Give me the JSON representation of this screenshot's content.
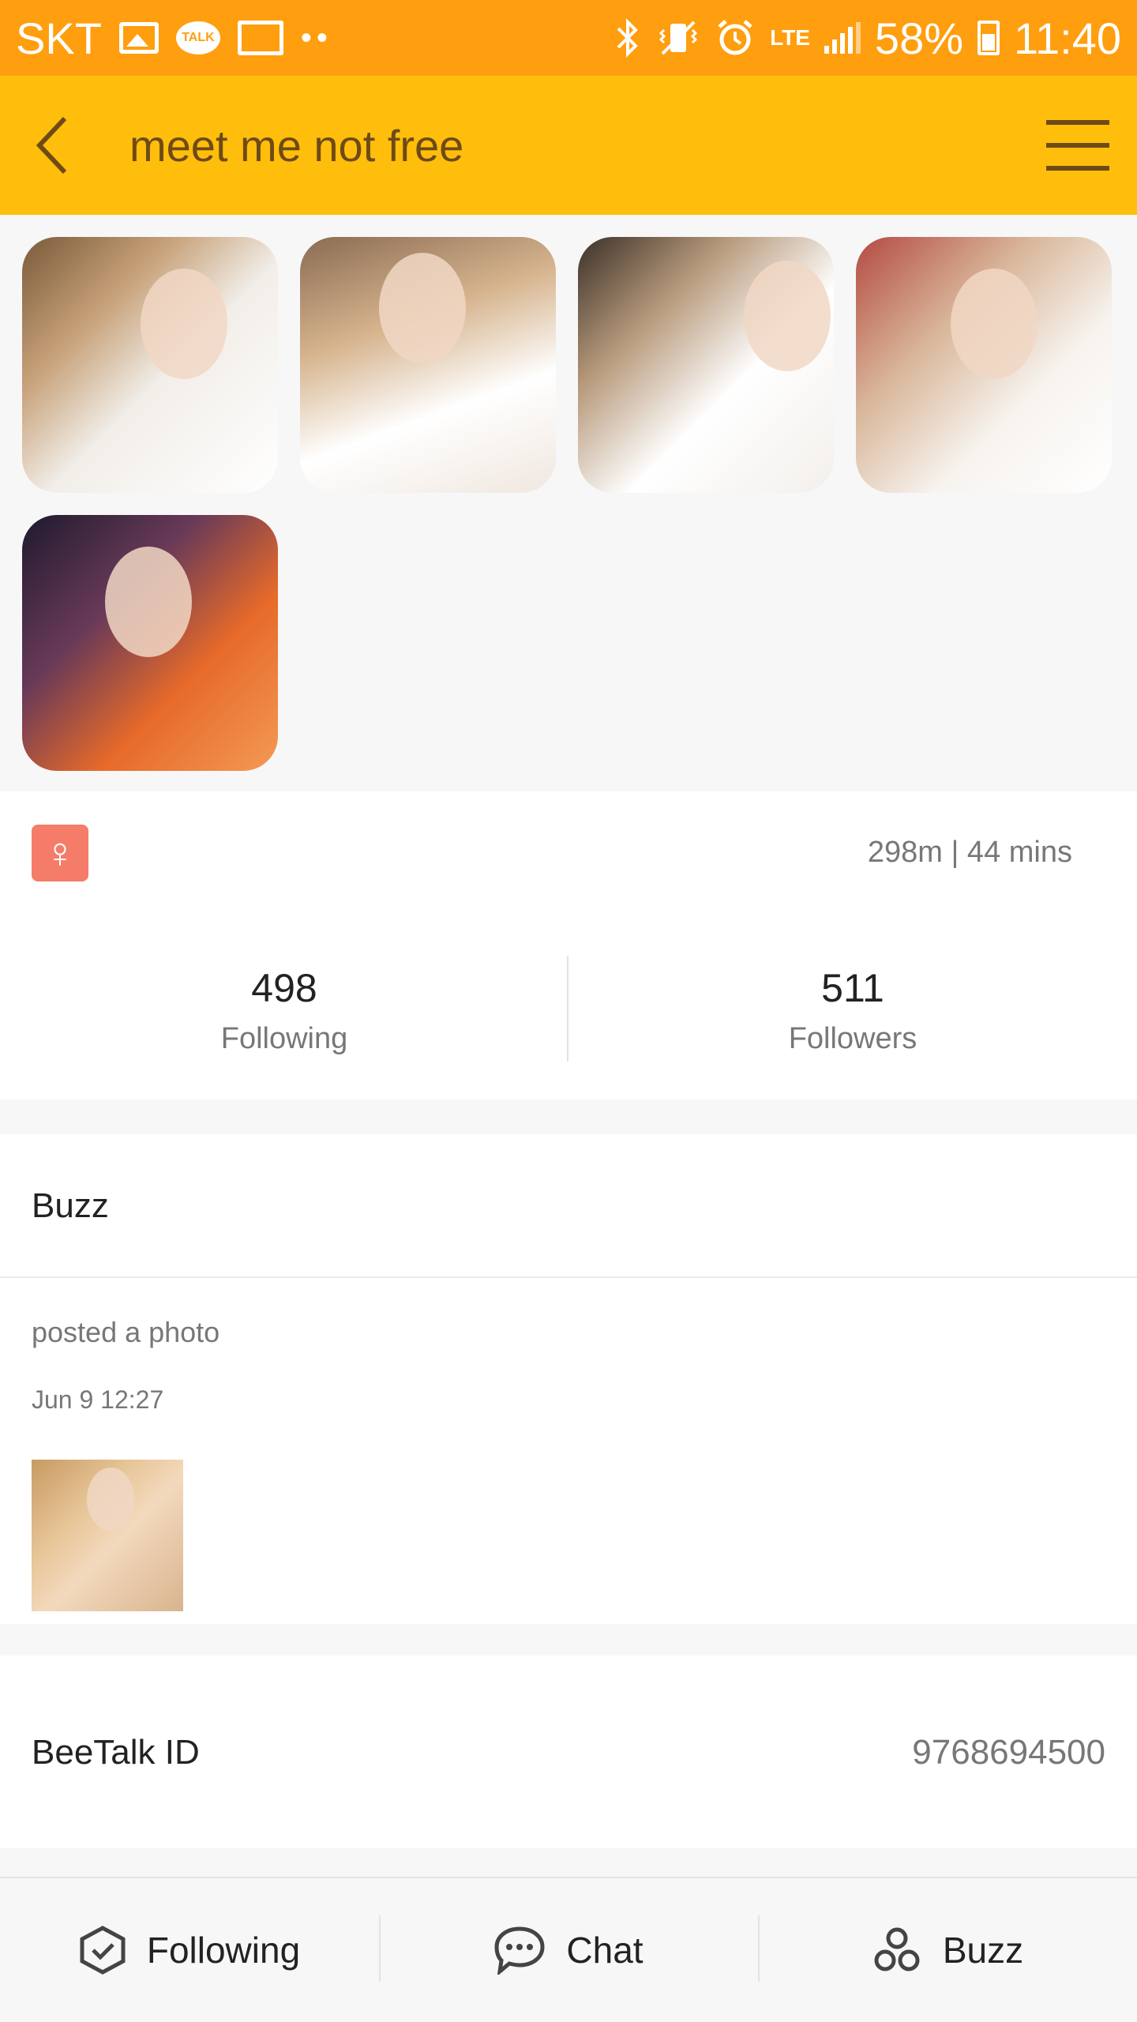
{
  "status_bar": {
    "carrier": "SKT",
    "talk_label": "TALK",
    "network": "LTE",
    "battery": "58%",
    "time": "11:40"
  },
  "app_bar": {
    "title": "meet me not free"
  },
  "profile": {
    "gender_symbol": "♀",
    "distance": "298m | 44 mins",
    "stats": [
      {
        "value": "498",
        "label": "Following"
      },
      {
        "value": "511",
        "label": "Followers"
      }
    ]
  },
  "buzz": {
    "header": "Buzz",
    "action": "posted a photo",
    "time": "Jun 9 12:27"
  },
  "beetalk_id": {
    "label": "BeeTalk ID",
    "value": "9768694500"
  },
  "bottom_bar": {
    "following_label": "Following",
    "chat_label": "Chat",
    "buzz_label": "Buzz"
  },
  "colors": {
    "status_bar": "#FF9E0E",
    "app_bar": "#FFBE0B",
    "gender_badge": "#F47C68"
  }
}
